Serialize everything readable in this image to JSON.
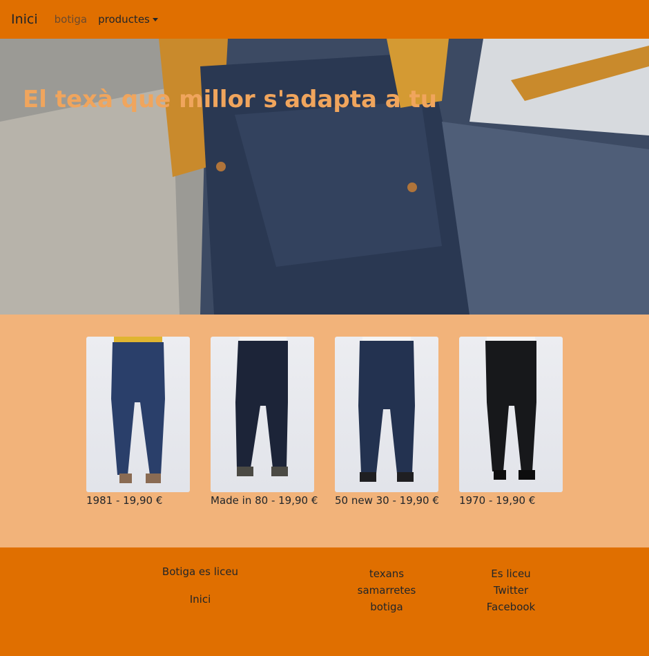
{
  "navbar": {
    "brand": "Inici",
    "links": [
      {
        "label": "botiga"
      },
      {
        "label": "productes"
      }
    ]
  },
  "hero": {
    "title": "El texà que millor s'adapta a tu"
  },
  "products": [
    {
      "caption": "1981 - 19,90 €"
    },
    {
      "caption": "Made in 80 - 19,90 €"
    },
    {
      "caption": "50 new 30 - 19,90 €"
    },
    {
      "caption": "1970 - 19,90 €"
    }
  ],
  "footer": {
    "col1": {
      "title": "Botiga es liceu",
      "link": "Inici"
    },
    "col2": {
      "links": [
        "texans",
        "samarretes",
        "botiga"
      ]
    },
    "col3": {
      "links": [
        "Es liceu",
        "Twitter",
        "Facebook"
      ]
    }
  },
  "colors": {
    "nav_bg": "#e06f00",
    "page_bg": "#f2b37a",
    "hero_title": "#f0a55d"
  }
}
